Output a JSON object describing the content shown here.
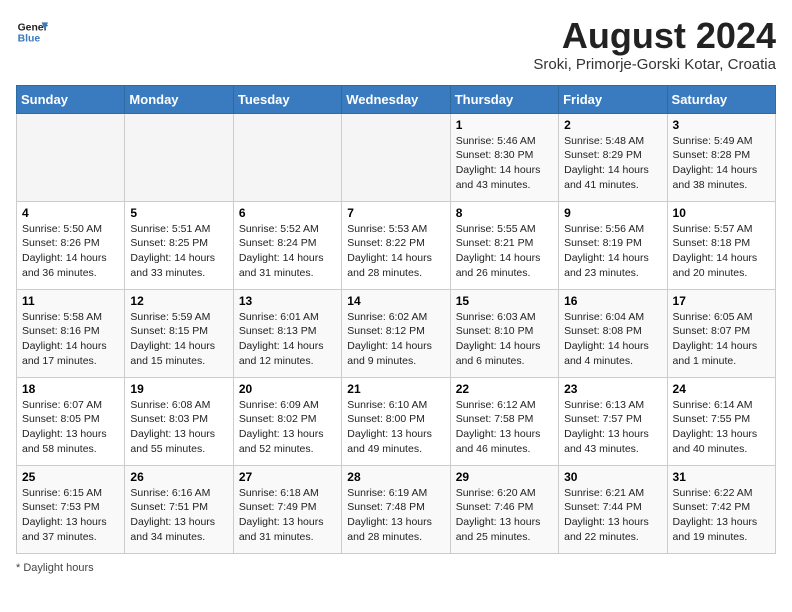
{
  "header": {
    "logo_line1": "General",
    "logo_line2": "Blue",
    "month_title": "August 2024",
    "location": "Sroki, Primorje-Gorski Kotar, Croatia"
  },
  "weekdays": [
    "Sunday",
    "Monday",
    "Tuesday",
    "Wednesday",
    "Thursday",
    "Friday",
    "Saturday"
  ],
  "weeks": [
    [
      {
        "day": "",
        "info": ""
      },
      {
        "day": "",
        "info": ""
      },
      {
        "day": "",
        "info": ""
      },
      {
        "day": "",
        "info": ""
      },
      {
        "day": "1",
        "info": "Sunrise: 5:46 AM\nSunset: 8:30 PM\nDaylight: 14 hours and 43 minutes."
      },
      {
        "day": "2",
        "info": "Sunrise: 5:48 AM\nSunset: 8:29 PM\nDaylight: 14 hours and 41 minutes."
      },
      {
        "day": "3",
        "info": "Sunrise: 5:49 AM\nSunset: 8:28 PM\nDaylight: 14 hours and 38 minutes."
      }
    ],
    [
      {
        "day": "4",
        "info": "Sunrise: 5:50 AM\nSunset: 8:26 PM\nDaylight: 14 hours and 36 minutes."
      },
      {
        "day": "5",
        "info": "Sunrise: 5:51 AM\nSunset: 8:25 PM\nDaylight: 14 hours and 33 minutes."
      },
      {
        "day": "6",
        "info": "Sunrise: 5:52 AM\nSunset: 8:24 PM\nDaylight: 14 hours and 31 minutes."
      },
      {
        "day": "7",
        "info": "Sunrise: 5:53 AM\nSunset: 8:22 PM\nDaylight: 14 hours and 28 minutes."
      },
      {
        "day": "8",
        "info": "Sunrise: 5:55 AM\nSunset: 8:21 PM\nDaylight: 14 hours and 26 minutes."
      },
      {
        "day": "9",
        "info": "Sunrise: 5:56 AM\nSunset: 8:19 PM\nDaylight: 14 hours and 23 minutes."
      },
      {
        "day": "10",
        "info": "Sunrise: 5:57 AM\nSunset: 8:18 PM\nDaylight: 14 hours and 20 minutes."
      }
    ],
    [
      {
        "day": "11",
        "info": "Sunrise: 5:58 AM\nSunset: 8:16 PM\nDaylight: 14 hours and 17 minutes."
      },
      {
        "day": "12",
        "info": "Sunrise: 5:59 AM\nSunset: 8:15 PM\nDaylight: 14 hours and 15 minutes."
      },
      {
        "day": "13",
        "info": "Sunrise: 6:01 AM\nSunset: 8:13 PM\nDaylight: 14 hours and 12 minutes."
      },
      {
        "day": "14",
        "info": "Sunrise: 6:02 AM\nSunset: 8:12 PM\nDaylight: 14 hours and 9 minutes."
      },
      {
        "day": "15",
        "info": "Sunrise: 6:03 AM\nSunset: 8:10 PM\nDaylight: 14 hours and 6 minutes."
      },
      {
        "day": "16",
        "info": "Sunrise: 6:04 AM\nSunset: 8:08 PM\nDaylight: 14 hours and 4 minutes."
      },
      {
        "day": "17",
        "info": "Sunrise: 6:05 AM\nSunset: 8:07 PM\nDaylight: 14 hours and 1 minute."
      }
    ],
    [
      {
        "day": "18",
        "info": "Sunrise: 6:07 AM\nSunset: 8:05 PM\nDaylight: 13 hours and 58 minutes."
      },
      {
        "day": "19",
        "info": "Sunrise: 6:08 AM\nSunset: 8:03 PM\nDaylight: 13 hours and 55 minutes."
      },
      {
        "day": "20",
        "info": "Sunrise: 6:09 AM\nSunset: 8:02 PM\nDaylight: 13 hours and 52 minutes."
      },
      {
        "day": "21",
        "info": "Sunrise: 6:10 AM\nSunset: 8:00 PM\nDaylight: 13 hours and 49 minutes."
      },
      {
        "day": "22",
        "info": "Sunrise: 6:12 AM\nSunset: 7:58 PM\nDaylight: 13 hours and 46 minutes."
      },
      {
        "day": "23",
        "info": "Sunrise: 6:13 AM\nSunset: 7:57 PM\nDaylight: 13 hours and 43 minutes."
      },
      {
        "day": "24",
        "info": "Sunrise: 6:14 AM\nSunset: 7:55 PM\nDaylight: 13 hours and 40 minutes."
      }
    ],
    [
      {
        "day": "25",
        "info": "Sunrise: 6:15 AM\nSunset: 7:53 PM\nDaylight: 13 hours and 37 minutes."
      },
      {
        "day": "26",
        "info": "Sunrise: 6:16 AM\nSunset: 7:51 PM\nDaylight: 13 hours and 34 minutes."
      },
      {
        "day": "27",
        "info": "Sunrise: 6:18 AM\nSunset: 7:49 PM\nDaylight: 13 hours and 31 minutes."
      },
      {
        "day": "28",
        "info": "Sunrise: 6:19 AM\nSunset: 7:48 PM\nDaylight: 13 hours and 28 minutes."
      },
      {
        "day": "29",
        "info": "Sunrise: 6:20 AM\nSunset: 7:46 PM\nDaylight: 13 hours and 25 minutes."
      },
      {
        "day": "30",
        "info": "Sunrise: 6:21 AM\nSunset: 7:44 PM\nDaylight: 13 hours and 22 minutes."
      },
      {
        "day": "31",
        "info": "Sunrise: 6:22 AM\nSunset: 7:42 PM\nDaylight: 13 hours and 19 minutes."
      }
    ]
  ],
  "footer": {
    "note": "Daylight hours"
  }
}
